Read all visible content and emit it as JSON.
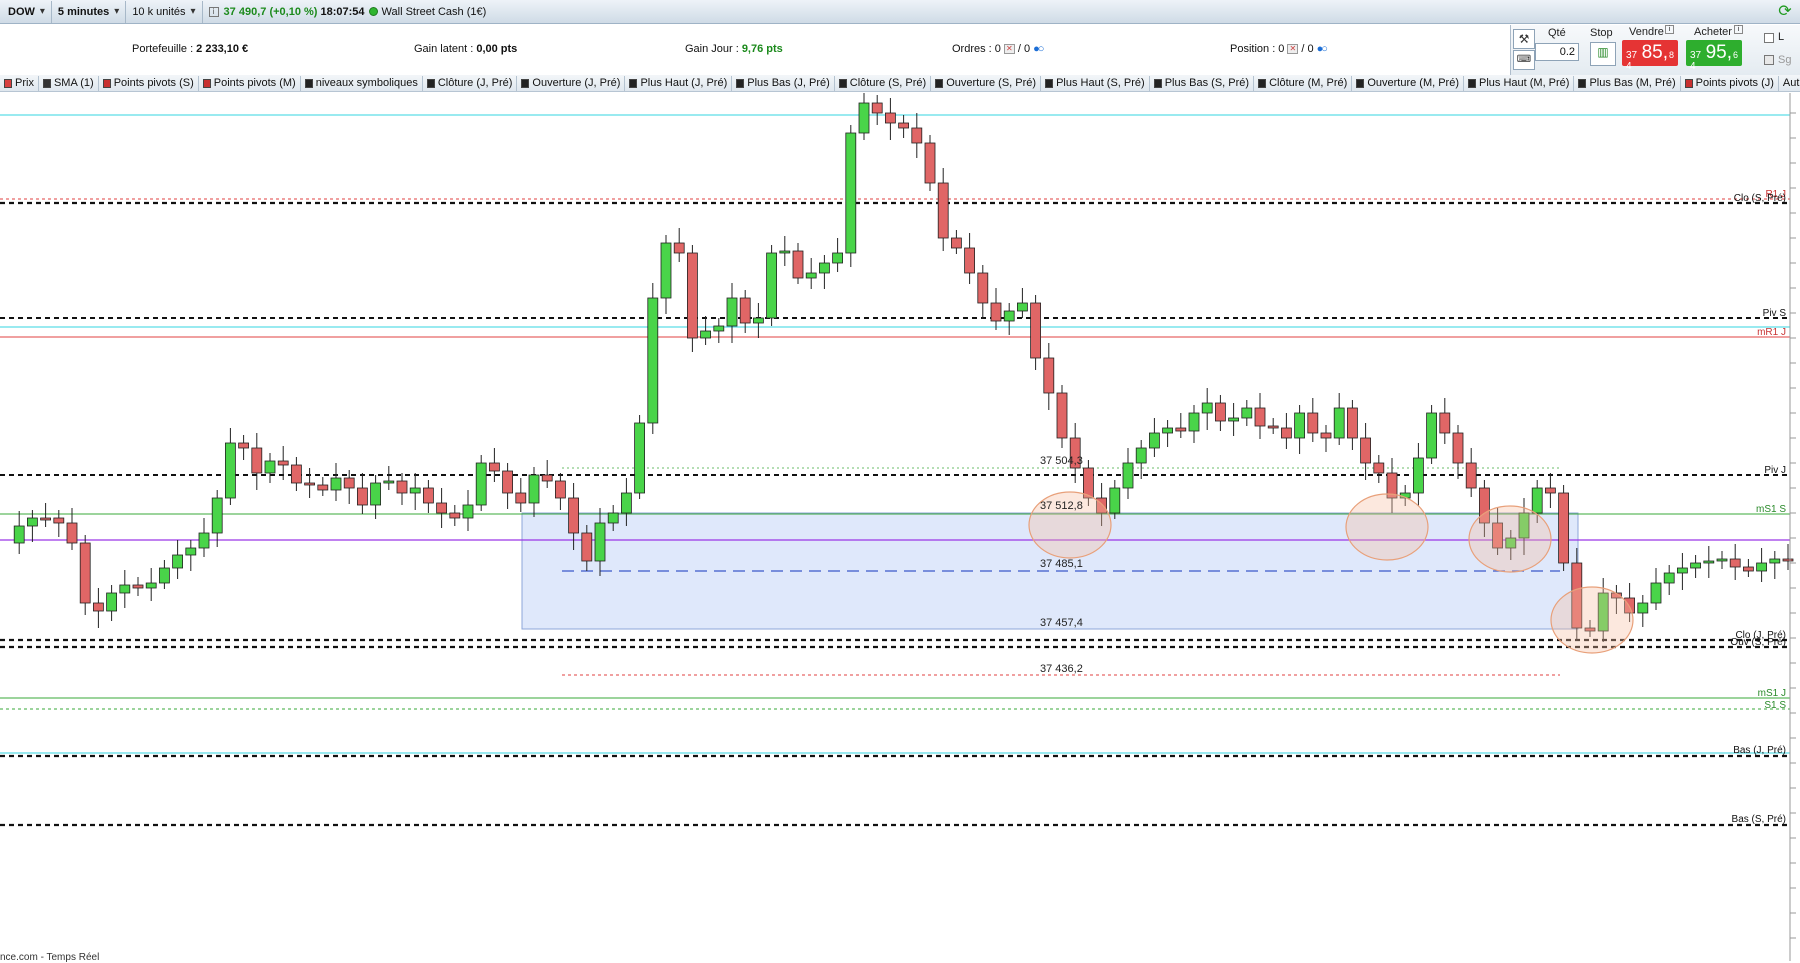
{
  "topbar": {
    "instrument": "DOW",
    "timeframe": "5 minutes",
    "units": "10 k unités",
    "price": "37 490,7",
    "change": "(+0,10 %)",
    "time": "18:07:54",
    "market_name": "Wall Street Cash (1€)"
  },
  "stats": {
    "portfolio_label": "Portefeuille :",
    "portfolio_value": "2 233,10 €",
    "latent_label": "Gain latent :",
    "latent_value": "0,00 pts",
    "day_gain_label": "Gain Jour :",
    "day_gain_value": "9,76 pts",
    "orders_label": "Ordres :",
    "orders_a": "0",
    "orders_b": "/ 0",
    "position_label": "Position :",
    "position_a": "0",
    "position_b": "/ 0"
  },
  "order_panel": {
    "qty_label": "Qté",
    "qty_value": "0.2",
    "stop_label": "Stop",
    "sell_label": "Vendre",
    "buy_label": "Acheter",
    "sell_small": "37 4",
    "sell_big": "85,",
    "sell_sup": "8",
    "buy_small": "37 4",
    "buy_big": "95,",
    "buy_sup": "6",
    "check_l": "L",
    "check_sg": "Sg"
  },
  "indicators": [
    {
      "label": "Prix",
      "color": "#d84040"
    },
    {
      "label": "SMA (1)",
      "color": "#333333"
    },
    {
      "label": "Points pivots (S)",
      "color": "#c83030"
    },
    {
      "label": "Points pivots (M)",
      "color": "#c83030"
    },
    {
      "label": "niveaux symboliques",
      "color": "#222222"
    },
    {
      "label": "Clôture (J, Pré)",
      "color": "#222222"
    },
    {
      "label": "Ouverture (J, Pré)",
      "color": "#222222"
    },
    {
      "label": "Plus Haut (J, Pré)",
      "color": "#222222"
    },
    {
      "label": "Plus Bas (J, Pré)",
      "color": "#222222"
    },
    {
      "label": "Clôture (S, Pré)",
      "color": "#222222"
    },
    {
      "label": "Ouverture (S, Pré)",
      "color": "#222222"
    },
    {
      "label": "Plus Haut (S, Pré)",
      "color": "#222222"
    },
    {
      "label": "Plus Bas (S, Pré)",
      "color": "#222222"
    },
    {
      "label": "Clôture (M, Pré)",
      "color": "#222222"
    },
    {
      "label": "Ouverture (M, Pré)",
      "color": "#222222"
    },
    {
      "label": "Plus Haut (M, Pré)",
      "color": "#222222"
    },
    {
      "label": "Plus Bas (M, Pré)",
      "color": "#222222"
    },
    {
      "label": "Points pivots (J)",
      "color": "#c83030"
    },
    {
      "label": "Autres",
      "color": ""
    }
  ],
  "chart": {
    "zone_labels": [
      "37 512,8",
      "37 485,1",
      "37 457,4",
      "37 436,2",
      "37 504,3"
    ],
    "right_labels": [
      "R1 J",
      "Clo (S, Pré)",
      "Piv S",
      "mR1 J",
      "Piv J",
      "mS1 S",
      "Clo (J, Pré)",
      "Ouv (S, Pré)",
      "mS1 J",
      "S1 S",
      "Bas (J, Pré)",
      "Bas (S, Pré)"
    ]
  },
  "footer_text": "nce.com - Temps Réel",
  "colors": {
    "bull": "#49d449",
    "bear": "#e06666",
    "zone": "#dfe8fb",
    "cyan": "#33d6e0",
    "green_line": "#3aa83a",
    "purple": "#9a36e6",
    "red_line": "#e04040"
  }
}
